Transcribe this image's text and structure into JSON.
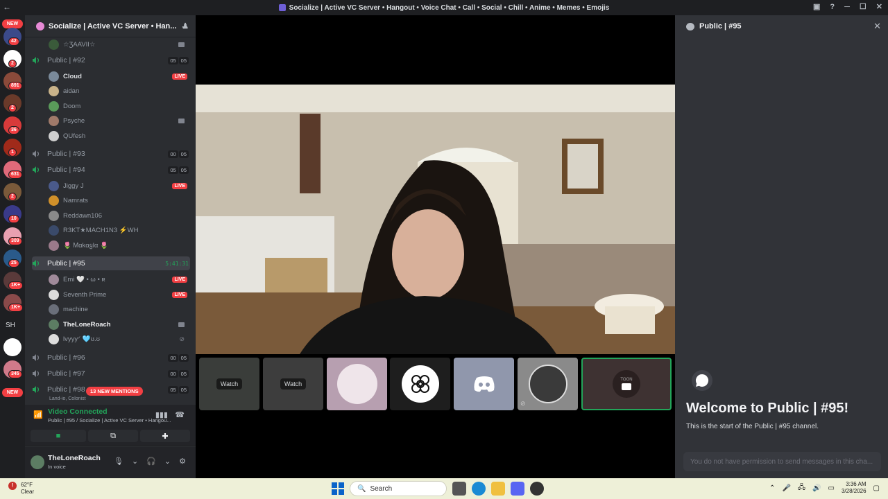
{
  "window": {
    "title": "Socialize | Active VC Server • Hangout • Voice Chat • Call • Social • Chill • Anime • Memes • Emojis"
  },
  "rail": {
    "new_top": "NEW",
    "badges": [
      "42",
      "2",
      "891",
      "2",
      "36",
      "1",
      "631",
      "2",
      "10",
      "309",
      "25",
      "1K+",
      "1K+",
      "345"
    ],
    "initials": "SH",
    "new_bottom": "NEW"
  },
  "server": {
    "name": "Socialize | Active VC Server • Han..."
  },
  "channels": {
    "top_user": "☆ƷAAVII☆",
    "public92": {
      "name": "Public | #92",
      "c1": "05",
      "c2": "05",
      "users": [
        "Cloud",
        "aidan",
        "Doom",
        "Psyche",
        "QUfesh"
      ],
      "live": "LIVE"
    },
    "public93": {
      "name": "Public | #93",
      "c1": "00",
      "c2": "05"
    },
    "public94": {
      "name": "Public | #94",
      "c1": "05",
      "c2": "05",
      "users": [
        "Jiggy J",
        "Namrats",
        "Reddawn106",
        "R3KT★MACH1N3 ⚡WH",
        "🌷 Ꮇαkαყlα 🌷"
      ],
      "live": "LIVE"
    },
    "public95": {
      "name": "Public | #95",
      "timer": "5:41:31",
      "users": [
        "Emi 🤍 • ω • ʀ",
        "Seventh Prime",
        "machine",
        "TheLoneRoach",
        "lvyyyᐟ 🩵ʊ.ʊ"
      ],
      "live": "LIVE"
    },
    "public96": {
      "name": "Public | #96",
      "c1": "00",
      "c2": "05"
    },
    "public97": {
      "name": "Public | #97",
      "c1": "00",
      "c2": "05"
    },
    "public98": {
      "name": "Public | #98",
      "c1": "05",
      "c2": "05",
      "sub": "Land-io, Colonist"
    }
  },
  "mentions": "13 NEW MENTIONS",
  "voice": {
    "status": "Video Connected",
    "location": "Public | #95 / Socialize | Active VC Server • Hangou..."
  },
  "user": {
    "name": "TheLoneRoach",
    "status": "In voice"
  },
  "tiles": {
    "watch1": "Watch",
    "watch2": "Watch",
    "last_label": "TOON"
  },
  "chat": {
    "channel": "Public | #95",
    "welcome_title": "Welcome to Public | #95!",
    "welcome_sub": "This is the start of the Public | #95 channel.",
    "input_placeholder": "You do not have permission to send messages in this cha..."
  },
  "taskbar": {
    "weather_temp": "62°F",
    "weather_cond": "Clear",
    "search": "Search",
    "time": "3:36 AM",
    "date": "3/28/2026"
  },
  "colors": {
    "live": "#f23f43",
    "connected": "#23a55a",
    "sidebar": "#2b2d31"
  }
}
